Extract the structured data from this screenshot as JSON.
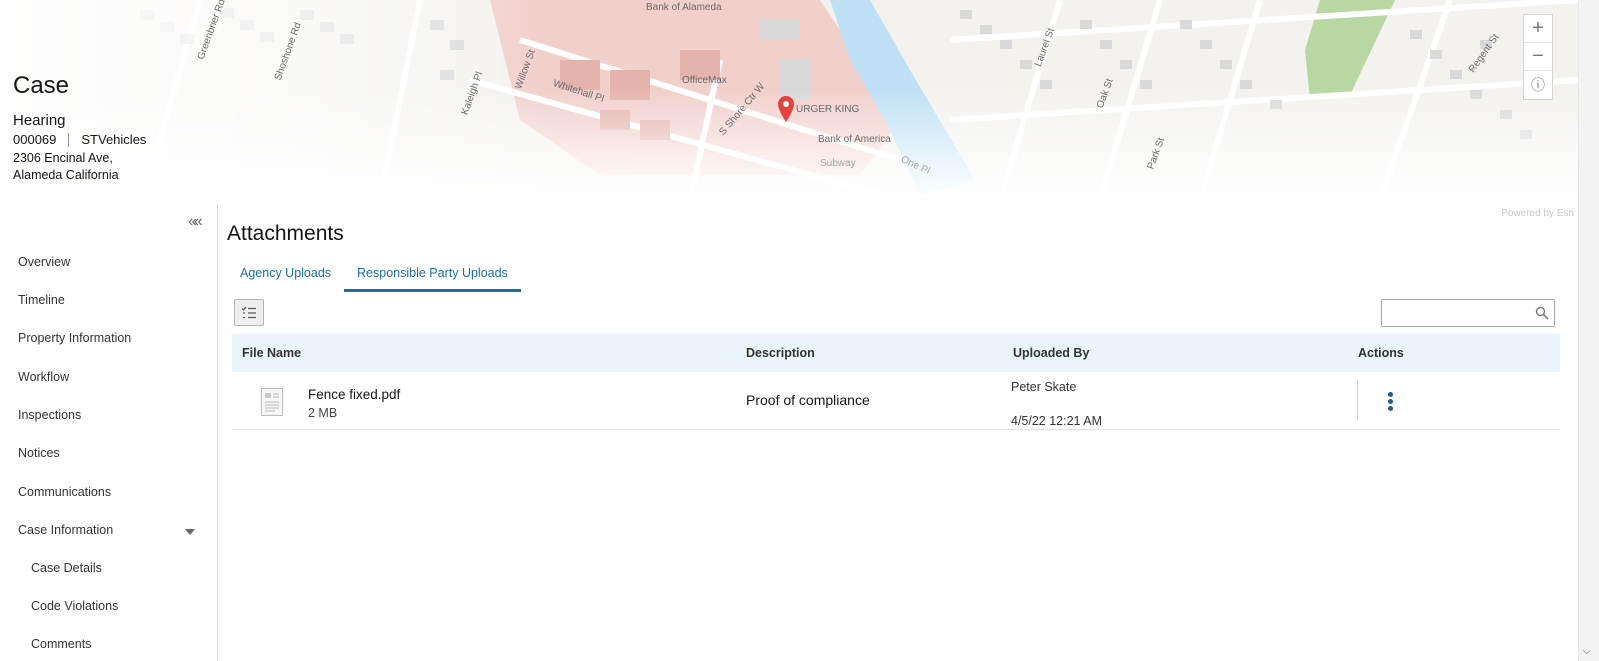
{
  "map": {
    "labels": [
      "Bank of Alameda",
      "OfficeMax",
      "URGER KING",
      "Bank of America",
      "Subway",
      "Whitehall Pl",
      "Willow St",
      "Kaleigh Pl",
      "S Shore Ctr W",
      "Oak St",
      "Laurel St",
      "Park St",
      "Regent St",
      "Greenbrier Rd",
      "Shoshone Rd",
      "One Pl"
    ],
    "credit": "Powered by Esri",
    "zoom_in": "+",
    "zoom_out": "−",
    "info": "ⓘ",
    "pin_color": "#e5403b"
  },
  "case": {
    "title": "Case",
    "status": "Hearing",
    "number": "000069",
    "type": "STVehicles",
    "address_line1": "2306 Encinal Ave,",
    "address_line2": "Alameda California"
  },
  "sidebar": {
    "collapse_icon": "««",
    "items": [
      "Overview",
      "Timeline",
      "Property Information",
      "Workflow",
      "Inspections",
      "Notices",
      "Communications",
      "Case Information"
    ],
    "sub_items": [
      "Case Details",
      "Code Violations",
      "Comments"
    ]
  },
  "main": {
    "title": "Attachments",
    "tabs": [
      "Agency Uploads",
      "Responsible Party Uploads"
    ],
    "active_tab": "Responsible Party Uploads",
    "search_placeholder": "",
    "columns": [
      "File Name",
      "Description",
      "Uploaded By",
      "Actions"
    ],
    "rows": [
      {
        "file_name": "Fence fixed.pdf",
        "file_size": "2 MB",
        "description": "Proof of compliance",
        "uploaded_by": "Peter Skate",
        "uploaded_at": "4/5/22 12:21 AM"
      }
    ]
  },
  "colors": {
    "accent": "#1c6ea4",
    "header_bg": "#eaf4fb",
    "kebab": "#1c5f92"
  }
}
